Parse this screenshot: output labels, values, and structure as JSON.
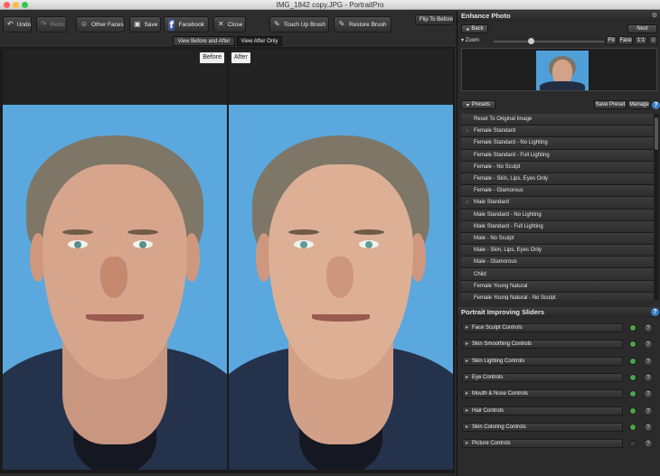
{
  "window": {
    "title": "IMG_1842 copy.JPG - PortraitPro"
  },
  "toolbar": {
    "undo": "Undo",
    "redo": "Redo",
    "other_faces": "Other Faces",
    "save": "Save",
    "facebook": "Facebook",
    "close": "Close",
    "touch_up": "Touch Up Brush",
    "restore": "Restore Brush",
    "flip": "Flip To Before",
    "view_both": "View Before and After",
    "view_after": "View After Only"
  },
  "canvas": {
    "before_label": "Before",
    "after_label": "After"
  },
  "enhance": {
    "title": "Enhance Photo",
    "back": "Back",
    "next": "Next",
    "zoom_label": "Zoom",
    "fit": "Fit",
    "face": "Face",
    "one_to_one": "1:1",
    "zoom_level": 0.34
  },
  "presets": {
    "header": "Presets",
    "save_preset": "Save Preset",
    "manage": "Manage",
    "items": [
      {
        "label": "Reset To Original Image",
        "icon": ""
      },
      {
        "label": "Female Standard",
        "icon": "female-icon"
      },
      {
        "label": "Female Standard - No Lighting",
        "icon": ""
      },
      {
        "label": "Female Standard - Full Lighting",
        "icon": ""
      },
      {
        "label": "Female - No Sculpt",
        "icon": ""
      },
      {
        "label": "Female - Skin, Lips, Eyes Only",
        "icon": ""
      },
      {
        "label": "Female - Glamorous",
        "icon": ""
      },
      {
        "label": "Male Standard",
        "icon": "male-icon"
      },
      {
        "label": "Male Standard - No Lighting",
        "icon": ""
      },
      {
        "label": "Male Standard - Full Lighting",
        "icon": ""
      },
      {
        "label": "Male - No Sculpt",
        "icon": ""
      },
      {
        "label": "Male - Skin, Lips, Eyes Only",
        "icon": ""
      },
      {
        "label": "Male - Glamorous",
        "icon": ""
      },
      {
        "label": "Child",
        "icon": ""
      },
      {
        "label": "Female Young Natural",
        "icon": ""
      },
      {
        "label": "Female Young Natural - No Sculpt",
        "icon": ""
      }
    ]
  },
  "sliders": {
    "header": "Portrait Improving Sliders",
    "groups": [
      {
        "label": "Face Sculpt Controls",
        "on": true
      },
      {
        "label": "Skin Smoothing Controls",
        "on": true
      },
      {
        "label": "Skin Lighting Controls",
        "on": true
      },
      {
        "label": "Eye Controls",
        "on": true
      },
      {
        "label": "Mouth & Nose Controls",
        "on": true
      },
      {
        "label": "Hair Controls",
        "on": true
      },
      {
        "label": "Skin Coloring Controls",
        "on": true
      },
      {
        "label": "Picture Controls",
        "on": false
      }
    ]
  },
  "colors": {
    "accent": "#3a7fc9",
    "background": "#2a2a2a",
    "sky": "#5aa8de",
    "facebook": "#3b5998"
  }
}
